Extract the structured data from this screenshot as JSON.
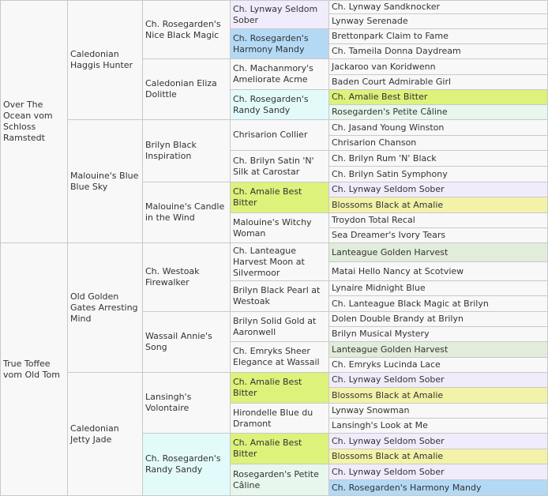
{
  "colors": {
    "default": "#f8f8f8",
    "lilac": "#f1ecfb",
    "blue": "#b3d9f5",
    "cyan": "#e3fafb",
    "lime": "#dcf27b",
    "yellow": "#f2f3a8",
    "mint": "#e7f7ed",
    "sage": "#e1ecdb"
  },
  "pedigree": {
    "generation_1": [
      {
        "name": "Over The Ocean vom Schloss Ramstedt",
        "color": "default"
      },
      {
        "name": "True Toffee vom Old Tom",
        "color": "default"
      }
    ],
    "generation_2": [
      {
        "name": "Caledonian Haggis Hunter",
        "color": "default"
      },
      {
        "name": "Malouine's Blue Blue Sky",
        "color": "default"
      },
      {
        "name": "Old Golden Gates Arresting Mind",
        "color": "default"
      },
      {
        "name": "Caledonian Jetty Jade",
        "color": "default"
      }
    ],
    "generation_3": [
      {
        "name": "Ch. Rosegarden's Nice Black Magic",
        "color": "default"
      },
      {
        "name": "Caledonian Eliza Dolittle",
        "color": "default"
      },
      {
        "name": "Brilyn Black Inspiration",
        "color": "default"
      },
      {
        "name": "Malouine's Candle in the Wind",
        "color": "default"
      },
      {
        "name": "Ch. Westoak Firewalker",
        "color": "default"
      },
      {
        "name": "Wassail Annie's Song",
        "color": "default"
      },
      {
        "name": "Lansingh's Volontaire",
        "color": "default"
      },
      {
        "name": "Ch. Rosegarden's Randy Sandy",
        "color": "cyan"
      }
    ],
    "generation_4": [
      {
        "name": "Ch. Lynway Seldom Sober",
        "color": "lilac"
      },
      {
        "name": "Ch. Rosegarden's Harmony Mandy",
        "color": "blue"
      },
      {
        "name": "Ch. Machanmory's Ameliorate Acme",
        "color": "default"
      },
      {
        "name": "Ch. Rosegarden's Randy Sandy",
        "color": "cyan"
      },
      {
        "name": "Chrisarion Collier",
        "color": "default"
      },
      {
        "name": "Ch. Brilyn Satin 'N' Silk at Carostar",
        "color": "default"
      },
      {
        "name": "Ch. Amalie Best Bitter",
        "color": "lime"
      },
      {
        "name": "Malouine's Witchy Woman",
        "color": "default"
      },
      {
        "name": "Ch. Lanteague Harvest Moon at Silvermoor",
        "color": "default"
      },
      {
        "name": "Brilyn Black Pearl at Westoak",
        "color": "default"
      },
      {
        "name": "Brilyn Solid Gold at Aaronwell",
        "color": "default"
      },
      {
        "name": "Ch. Emryks Sheer Elegance at Wassail",
        "color": "default"
      },
      {
        "name": "Ch. Amalie Best Bitter",
        "color": "lime"
      },
      {
        "name": "Hirondelle Blue du Dramont",
        "color": "default"
      },
      {
        "name": "Ch. Amalie Best Bitter",
        "color": "lime"
      },
      {
        "name": "Rosegarden's Petite Câline",
        "color": "mint"
      }
    ],
    "generation_5": [
      {
        "name": "Ch. Lynway Sandknocker",
        "color": "default"
      },
      {
        "name": "Lynway Serenade",
        "color": "default"
      },
      {
        "name": "Brettonpark Claim to Fame",
        "color": "default"
      },
      {
        "name": "Ch. Tameila Donna Daydream",
        "color": "default"
      },
      {
        "name": "Jackaroo van Koridwenn",
        "color": "default"
      },
      {
        "name": "Baden Court Admirable Girl",
        "color": "default"
      },
      {
        "name": "Ch. Amalie Best Bitter",
        "color": "lime"
      },
      {
        "name": "Rosegarden's Petite Câline",
        "color": "mint"
      },
      {
        "name": "Ch. Jasand Young Winston",
        "color": "default"
      },
      {
        "name": "Chrisarion Chanson",
        "color": "default"
      },
      {
        "name": "Ch. Brilyn Rum 'N' Black",
        "color": "default"
      },
      {
        "name": "Ch. Brilyn Satin Symphony",
        "color": "default"
      },
      {
        "name": "Ch. Lynway Seldom Sober",
        "color": "lilac"
      },
      {
        "name": "Blossoms Black at Amalie",
        "color": "yellow"
      },
      {
        "name": "Troydon Total Recal",
        "color": "default"
      },
      {
        "name": "Sea Dreamer's Ivory Tears",
        "color": "default"
      },
      {
        "name": "Lanteague Golden Harvest",
        "color": "sage"
      },
      {
        "name": "Matai Hello Nancy at Scotview",
        "color": "default"
      },
      {
        "name": "Lynaire Midnight Blue",
        "color": "default"
      },
      {
        "name": "Ch. Lanteague Black Magic at Brilyn",
        "color": "default"
      },
      {
        "name": "Dolen Double Brandy at Brilyn",
        "color": "default"
      },
      {
        "name": "Brilyn Musical Mystery",
        "color": "default"
      },
      {
        "name": "Lanteague Golden Harvest",
        "color": "sage"
      },
      {
        "name": "Ch. Emryks Lucinda Lace",
        "color": "default"
      },
      {
        "name": "Ch. Lynway Seldom Sober",
        "color": "lilac"
      },
      {
        "name": "Blossoms Black at Amalie",
        "color": "yellow"
      },
      {
        "name": "Lynway Snowman",
        "color": "default"
      },
      {
        "name": "Lansingh's Look at Me",
        "color": "default"
      },
      {
        "name": "Ch. Lynway Seldom Sober",
        "color": "lilac"
      },
      {
        "name": "Blossoms Black at Amalie",
        "color": "yellow"
      },
      {
        "name": "Ch. Lynway Seldom Sober",
        "color": "lilac"
      },
      {
        "name": "Ch. Rosegarden's Harmony Mandy",
        "color": "blue"
      }
    ]
  }
}
